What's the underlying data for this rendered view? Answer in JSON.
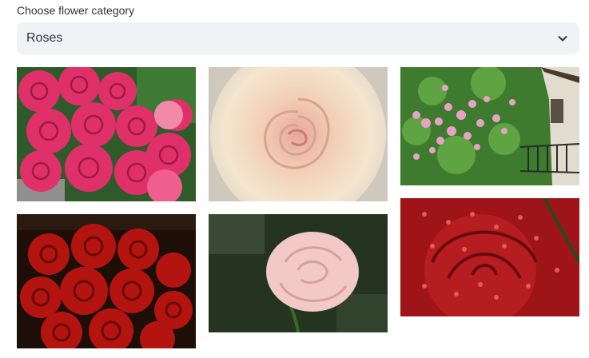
{
  "selector": {
    "label": "Choose flower category",
    "selected": "Roses",
    "icon": "chevron-down-icon"
  },
  "gallery": {
    "images": [
      {
        "id": "pink-rose-bouquet",
        "description": "bouquet of hot pink roses"
      },
      {
        "id": "cream-rose-closeup",
        "description": "close-up of a cream and peach rose"
      },
      {
        "id": "climbing-roses-balcony",
        "description": "pink climbing roses on a building with a balcony"
      },
      {
        "id": "red-rose-bouquet",
        "description": "bouquet of deep red roses"
      },
      {
        "id": "pale-pink-rose",
        "description": "single pale pink rose against dark foliage"
      },
      {
        "id": "red-rose-dewdrops",
        "description": "red rose petals covered in water droplets"
      }
    ]
  }
}
